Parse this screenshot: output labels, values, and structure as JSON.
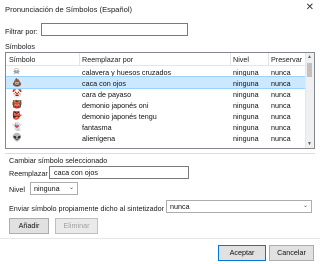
{
  "window": {
    "title": "Pronunciación de Símbolos (Español)",
    "close_glyph": "✕"
  },
  "filter": {
    "label": "Filtrar por:",
    "value": ""
  },
  "symbols_label": "Símbolos",
  "table": {
    "columns": [
      "Símbolo",
      "Reemplazar por",
      "Nivel",
      "Preservar"
    ],
    "rows": [
      {
        "icon": "skull-crossbones-icon",
        "glyph": "☠",
        "replacement": "calavera y huesos cruzados",
        "level": "ninguna",
        "preserve": "nunca",
        "selected": false
      },
      {
        "icon": "pile-of-poo-icon",
        "glyph": "💩",
        "replacement": "caca con ojos",
        "level": "ninguna",
        "preserve": "nunca",
        "selected": true
      },
      {
        "icon": "clown-face-icon",
        "glyph": "🤡",
        "replacement": "cara de payaso",
        "level": "ninguna",
        "preserve": "nunca",
        "selected": false
      },
      {
        "icon": "ogre-icon",
        "glyph": "👹",
        "replacement": "demonio japonés oni",
        "level": "ninguna",
        "preserve": "nunca",
        "selected": false
      },
      {
        "icon": "goblin-icon",
        "glyph": "👺",
        "replacement": "demonio japonés tengu",
        "level": "ninguna",
        "preserve": "nunca",
        "selected": false
      },
      {
        "icon": "ghost-icon",
        "glyph": "👻",
        "replacement": "fantasma",
        "level": "ninguna",
        "preserve": "nunca",
        "selected": false
      },
      {
        "icon": "alien-icon",
        "glyph": "👽",
        "replacement": "alienígena",
        "level": "ninguna",
        "preserve": "nunca",
        "selected": false
      }
    ]
  },
  "change_group": {
    "title": "Cambiar símbolo seleccionado",
    "replace_label": "Reemplazar",
    "replace_value": "caca con ojos",
    "level_label": "Nivel",
    "level_value": "ninguna",
    "send_label": "Enviar símbolo propiamente dicho al sintetizador",
    "send_value": "nunca"
  },
  "buttons": {
    "add": "Añadir",
    "remove": "Eliminar",
    "ok": "Aceptar",
    "cancel": "Cancelar"
  }
}
